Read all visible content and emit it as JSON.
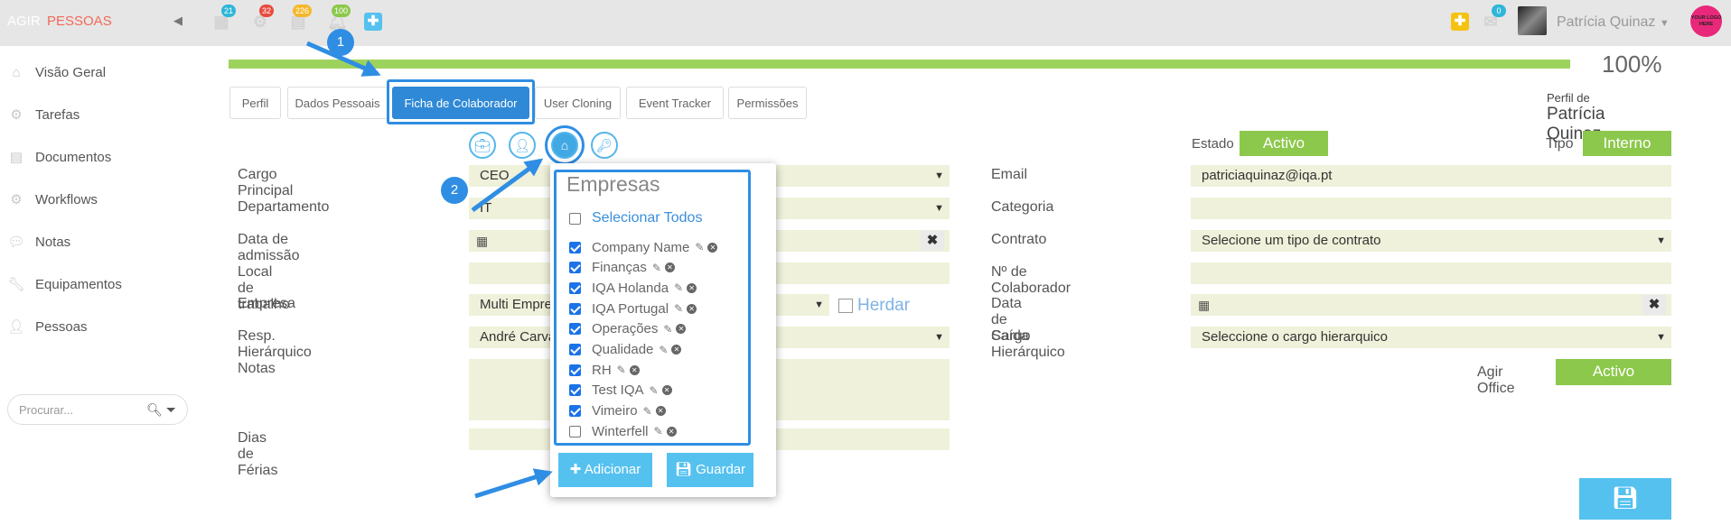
{
  "header": {
    "brand_a": "AGIR",
    "brand_b": "PESSOAS",
    "badges": {
      "calendar": "21",
      "tasks": "32",
      "documents": "226",
      "notifications": "100",
      "messages": "0"
    },
    "user_name": "Patrícia Quinaz",
    "logo_text": "YOUR LOGO HERE"
  },
  "sidebar": {
    "items": [
      {
        "label": "Visão Geral",
        "icon": "home-icon"
      },
      {
        "label": "Tarefas",
        "icon": "gear-icon"
      },
      {
        "label": "Documentos",
        "icon": "document-icon"
      },
      {
        "label": "Workflows",
        "icon": "cogs-icon"
      },
      {
        "label": "Notas",
        "icon": "comments-icon"
      },
      {
        "label": "Equipamentos",
        "icon": "wrench-icon"
      },
      {
        "label": "Pessoas",
        "icon": "user-icon"
      }
    ],
    "search_placeholder": "Procurar..."
  },
  "progress": {
    "value": 1.0,
    "label": "100%"
  },
  "tabs": [
    {
      "label": "Perfil",
      "active": false
    },
    {
      "label": "Dados Pessoais",
      "active": false
    },
    {
      "label": "Ficha de Colaborador",
      "active": true
    },
    {
      "label": "User Cloning",
      "active": false
    },
    {
      "label": "Event Tracker",
      "active": false
    },
    {
      "label": "Permissões",
      "active": false
    }
  ],
  "profile": {
    "prefix": "Perfil de",
    "name": "Patrícia Quinaz"
  },
  "form": {
    "estado_label": "Estado",
    "estado_value": "Activo",
    "tipo_label": "Tipo",
    "tipo_value": "Interno",
    "left": {
      "cargo_label": "Cargo Principal",
      "cargo_value": "CEO",
      "departamento_label": "Departamento",
      "departamento_value": "IT",
      "admissao_label": "Data de admissão",
      "local_label": "Local de trabalho",
      "empresa_label": "Empresa",
      "empresa_value": "Multi Empre",
      "herdar_label": "Herdar",
      "resp_label": "Resp. Hierárquico",
      "resp_value": "André Carva",
      "notas_label": "Notas",
      "ferias_label": "Dias de Férias"
    },
    "right": {
      "email_label": "Email",
      "email_value": "patriciaquinaz@iqa.pt",
      "categoria_label": "Categoria",
      "contrato_label": "Contrato",
      "contrato_value": "Selecione um tipo de contrato",
      "numero_label": "Nº de Colaborador",
      "saida_label": "Data de Saída",
      "cargo_hier_label": "Cargo Hierárquico",
      "cargo_hier_value": "Seleccione o cargo hierarquico",
      "office_label": "Agir Office",
      "office_value": "Activo"
    }
  },
  "popup": {
    "title": "Empresas",
    "select_all": "Selecionar Todos",
    "companies": [
      {
        "name": "Company Name",
        "checked": true
      },
      {
        "name": "Finanças",
        "checked": true
      },
      {
        "name": "IQA Holanda",
        "checked": true
      },
      {
        "name": "IQA Portugal",
        "checked": true
      },
      {
        "name": "Operações",
        "checked": true
      },
      {
        "name": "Qualidade",
        "checked": true
      },
      {
        "name": "RH",
        "checked": true
      },
      {
        "name": "Test IQA",
        "checked": true
      },
      {
        "name": "Vimeiro",
        "checked": true
      },
      {
        "name": "Winterfell",
        "checked": false
      }
    ],
    "add_label": "Adicionar",
    "save_label": "Guardar"
  },
  "annotations": {
    "step1": "1",
    "step2": "2"
  },
  "colors": {
    "accent": "#2f89d6",
    "green": "#8cc84b",
    "progress": "#9dd35c",
    "popup_button": "#55c1ef",
    "field_bg": "#eff1da"
  }
}
